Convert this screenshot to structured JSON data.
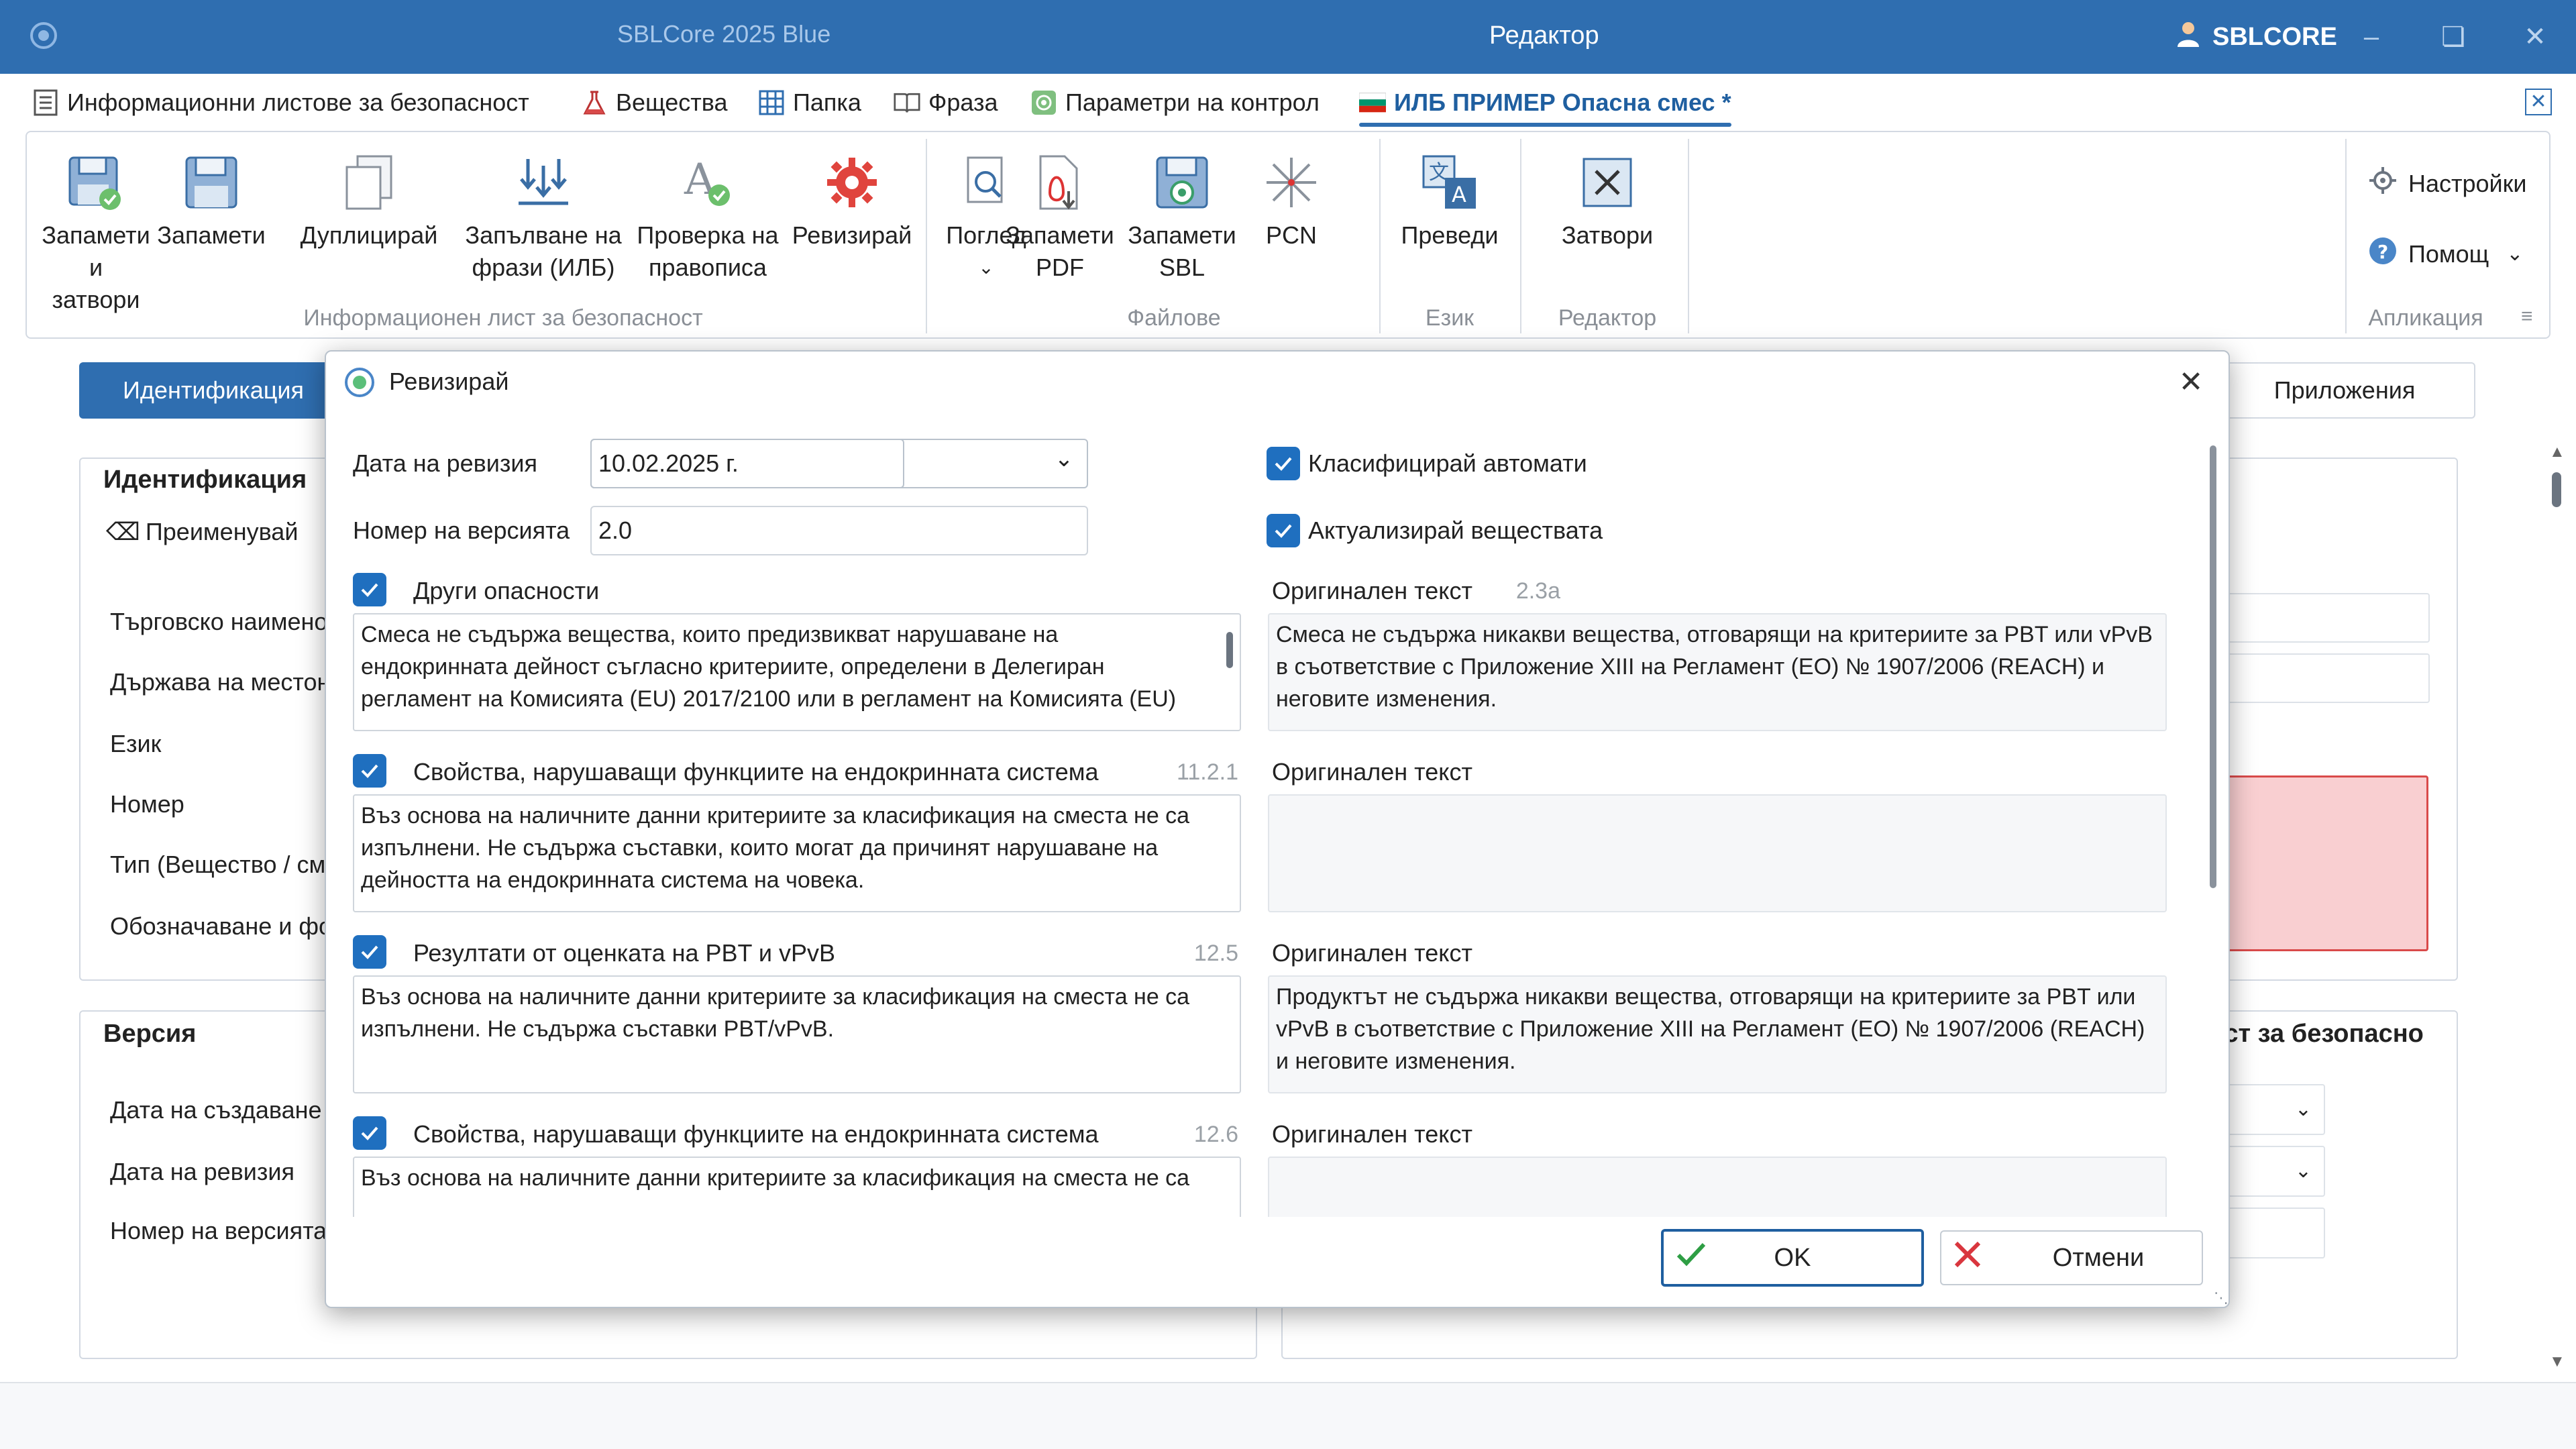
{
  "titlebar": {
    "app_name": "SBLCore 2025 Blue",
    "window_title": "Редактор",
    "user": "SBLCORE"
  },
  "tabs": [
    {
      "label": "Информационни листове за безопасност",
      "icon": "document-list-icon"
    },
    {
      "label": "Вещества",
      "icon": "flask-icon"
    },
    {
      "label": "Папка",
      "icon": "grid-icon"
    },
    {
      "label": "Фраза",
      "icon": "book-icon"
    },
    {
      "label": "Параметри на контрол",
      "icon": "target-icon"
    },
    {
      "label": "ИЛБ ПРИМЕР Опасна смес *",
      "icon": "bulgaria-flag-icon"
    }
  ],
  "ribbon": {
    "groups": [
      {
        "label": "Информационен лист за безопасност"
      },
      {
        "label": "Файлове"
      },
      {
        "label": "Език"
      },
      {
        "label": "Редактор"
      },
      {
        "label": "Апликация"
      }
    ],
    "buttons": {
      "save_close": [
        "Запамети",
        "и затвори"
      ],
      "save": [
        "Запамети"
      ],
      "duplicate": [
        "Дуплицирай"
      ],
      "fill_phrases": [
        "Запълване на",
        "фрази (ИЛБ)"
      ],
      "spellcheck": [
        "Проверка на",
        "правописа"
      ],
      "revise": [
        "Ревизирай"
      ],
      "view": [
        "Поглед"
      ],
      "save_pdf": [
        "Запамети",
        "PDF"
      ],
      "save_sbl": [
        "Запамети",
        "SBL"
      ],
      "pcn": [
        "PCN"
      ],
      "translate": [
        "Преведи"
      ],
      "close": [
        "Затвори"
      ],
      "settings": "Настройки",
      "help": "Помощ"
    }
  },
  "background": {
    "left_tab": "Идентификация",
    "right_tab": "Приложения",
    "ident_panel": {
      "title": "Идентификация",
      "rename": "Преименувай",
      "rows": [
        "Търговско наимено",
        "Държава на местон",
        "Език",
        "Номер",
        "Тип (Вещество / см",
        "Обозначаване и фо"
      ]
    },
    "version_panel": {
      "title": "Версия",
      "rows": [
        "Дата на създаване",
        "Дата на ревизия",
        "Номер на версията"
      ]
    },
    "right_panel_title": "ист за безопасно"
  },
  "dialog": {
    "title": "Ревизирай",
    "revision_date_label": "Дата на ревизия",
    "revision_date_value": "10.02.2025 г.",
    "version_label": "Номер на версията",
    "version_value": "2.0",
    "auto_classify": "Класифицирай автомати",
    "update_substances": "Актуализирай веществата",
    "original_text_label": "Оригинален текст",
    "sections": [
      {
        "title": "Други опасности",
        "number": "2.3a",
        "text": "Смеса не съдържа вещества, които предизвикват нарушаване на ендокринната дейност съгласно критериите, определени в Делегиран регламент на Комисията (EU) 2017/2100 или в регламент на Комисията (EU)",
        "original": "Смеса не съдържа никакви вещества, отговарящи на критериите за PBT или vPvB в съответствие с Приложение XIII на Регламент (ЕО) № 1907/2006 (REACH) и неговите изменения."
      },
      {
        "title": "Свойства, нарушаващи функциите на ендокринната система",
        "number": "11.2.1",
        "text": "Въз основа на наличните данни критериите за класификация на сместа не са изпълнени. Не съдържа съставки, които могат да причинят нарушаване на дейността на ендокринната система на човека.",
        "original": ""
      },
      {
        "title": "Резултати от оценката на PBT и vPvB",
        "number": "12.5",
        "text": "Въз основа на наличните данни критериите за класификация на сместа не са изпълнени. Не съдържа съставки PBT/vPvB.",
        "original": "Продуктът не съдържа никакви вещества, отговарящи на критериите за PBT или vPvB в съответствие с Приложение XIII на Регламент (ЕО) № 1907/2006 (REACH) и неговите изменения."
      },
      {
        "title": "Свойства, нарушаващи функциите на ендокринната система",
        "number": "12.6",
        "text": "Въз основа на наличните данни критериите за класификация на сместа не са",
        "original": ""
      }
    ],
    "ok": "OK",
    "cancel": "Отмени"
  },
  "colors": {
    "titlebar": "#2f6eb0",
    "accent": "#1f6fbf",
    "cancel_red": "#d9363e",
    "ok_green": "#2e9e44"
  }
}
